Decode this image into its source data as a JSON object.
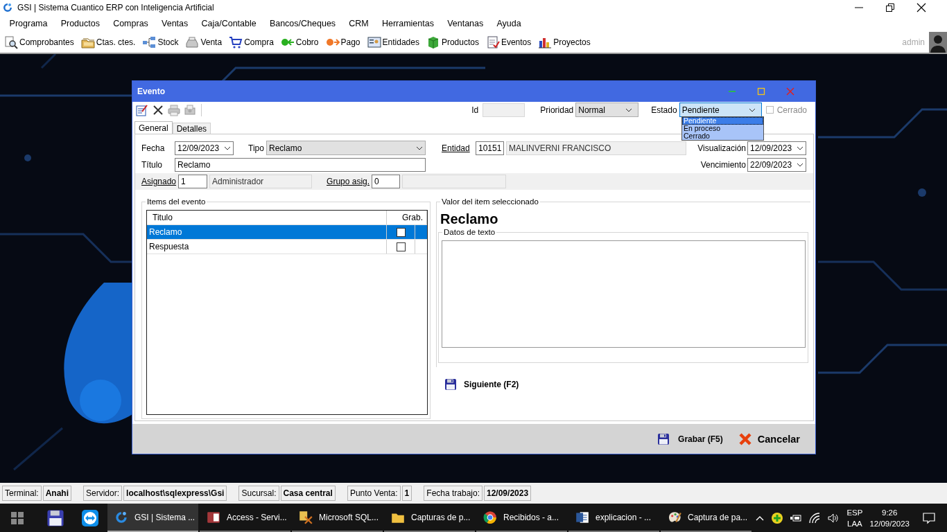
{
  "window": {
    "title": "GSI | Sistema Cuantico ERP con Inteligencia Artificial"
  },
  "menu": [
    "Programa",
    "Productos",
    "Compras",
    "Ventas",
    "Caja/Contable",
    "Bancos/Cheques",
    "CRM",
    "Herramientas",
    "Ventanas",
    "Ayuda"
  ],
  "toolbar": [
    "Comprobantes",
    "Ctas. ctes.",
    "Stock",
    "Venta",
    "Compra",
    "Cobro",
    "Pago",
    "Entidades",
    "Productos",
    "Eventos",
    "Proyectos"
  ],
  "user": {
    "name": "admin"
  },
  "dialog": {
    "title": "Evento",
    "id": {
      "label": "Id"
    },
    "prioridad": {
      "label": "Prioridad",
      "value": "Normal"
    },
    "estado": {
      "label": "Estado",
      "value": "Pendiente",
      "expanded": true,
      "options": [
        {
          "label": "Pendiente",
          "selected": true
        },
        {
          "label": "En proceso",
          "selected": false
        },
        {
          "label": "Cerrado",
          "selected": false
        }
      ]
    },
    "cerrado": {
      "label": "Cerrado",
      "checked": false,
      "disabled": true
    },
    "tabs": [
      {
        "label": "General",
        "selected": true
      },
      {
        "label": "Detalles",
        "selected": false
      }
    ],
    "fecha": {
      "label": "Fecha",
      "value": "12/09/2023"
    },
    "tipo": {
      "label": "Tipo",
      "value": "Reclamo"
    },
    "entidad": {
      "label": "Entidad",
      "code": "10151",
      "name": "MALINVERNI FRANCISCO"
    },
    "visualizacion": {
      "label": "Visualización",
      "value": "12/09/2023"
    },
    "titulo": {
      "label": "Título",
      "value": "Reclamo"
    },
    "vencimiento": {
      "label": "Vencimiento",
      "value": "22/09/2023"
    },
    "asignado": {
      "label": "Asignado",
      "code": "1",
      "name": "Administrador"
    },
    "grupo": {
      "label": "Grupo asig.",
      "code": "0"
    },
    "items": {
      "legend": "Items del evento",
      "columns": [
        "Titulo",
        "Grab."
      ],
      "rows": [
        {
          "title": "Reclamo",
          "grab": false,
          "selected": true
        },
        {
          "title": "Respuesta",
          "grab": false,
          "selected": false
        }
      ]
    },
    "valor": {
      "legend": "Valor del item seleccionado",
      "value": "Reclamo",
      "datos_legend": "Datos de texto"
    },
    "siguiente": "Siguiente (F2)",
    "buttons": [
      {
        "label": "Grabar (F5)",
        "kind": "save"
      },
      {
        "label": "Cancelar",
        "kind": "cancel"
      }
    ]
  },
  "status_bar": [
    {
      "label": "Terminal:",
      "value": "Anahi"
    },
    {
      "label": "Servidor:",
      "value": "localhost\\sqlexpress\\Gsi"
    },
    {
      "label": "Sucursal:",
      "value": "Casa central"
    },
    {
      "label": "Punto Venta:",
      "value": "1"
    },
    {
      "label": "Fecha trabajo:",
      "value": "12/09/2023"
    }
  ],
  "taskbar": {
    "apps": [
      {
        "label": "GSI | Sistema ...",
        "selected": true
      },
      {
        "label": "Access - Servi...",
        "selected": false
      },
      {
        "label": "Microsoft SQL...",
        "selected": false
      },
      {
        "label": "Capturas de p...",
        "selected": false
      },
      {
        "label": "Recibidos - a...",
        "selected": false
      },
      {
        "label": "explicacion - ...",
        "selected": false
      },
      {
        "label": "Captura de pa...",
        "selected": false
      }
    ],
    "tray": {
      "lang": "ESP",
      "layout": "LAA",
      "time": "9:26",
      "date": "12/09/2023"
    }
  }
}
